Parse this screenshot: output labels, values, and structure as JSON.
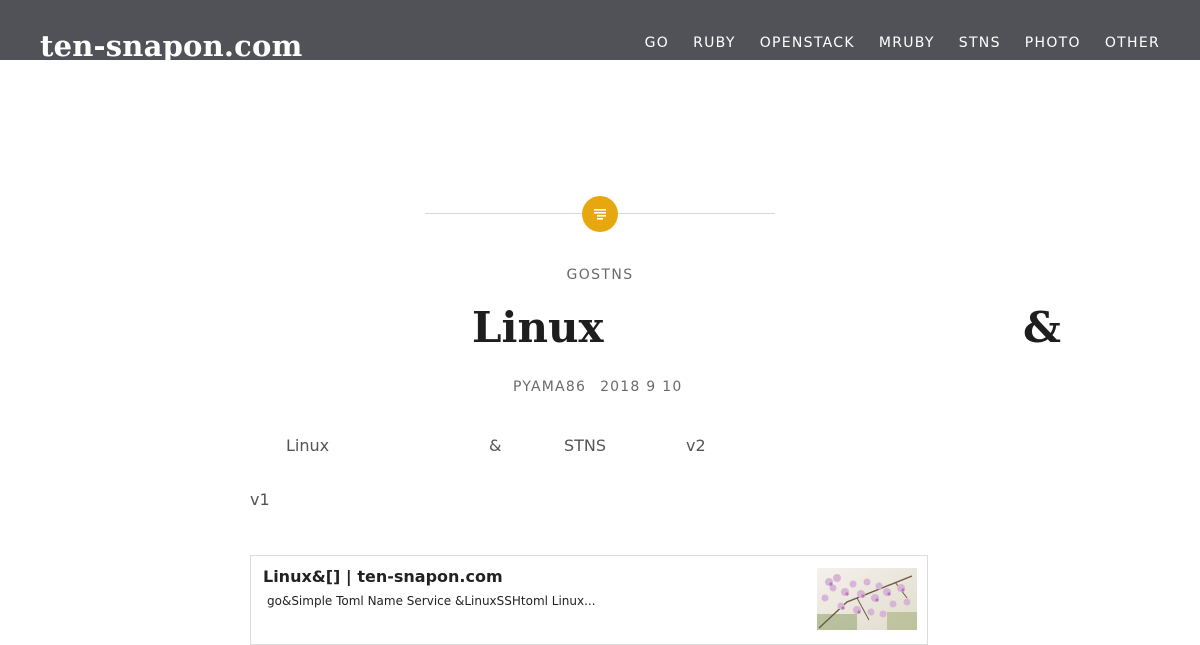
{
  "header": {
    "site_title": "ten-snapon.com",
    "nav": [
      {
        "label": "GO"
      },
      {
        "label": "RUBY"
      },
      {
        "label": "OPENSTACK"
      },
      {
        "label": "MRUBY"
      },
      {
        "label": "STNS"
      },
      {
        "label": "PHOTO"
      },
      {
        "label": "OTHER"
      }
    ],
    "background": "#505257"
  },
  "post": {
    "format_icon": "standard-post-icon",
    "accent_color": "#e6a711",
    "categories": [
      "GO",
      "STNS"
    ],
    "title_left": "Linux",
    "title_right": "&",
    "author": "PYAMA86",
    "date": "2018 9 10 ",
    "body": {
      "line1": {
        "a": "Linux",
        "b": "&",
        "c": "STNS",
        "d": "v2"
      },
      "line2": "v1"
    },
    "embed": {
      "title": "Linux&[] | ten-snapon.com",
      "excerpt": "go&Simple Toml Name Service &LinuxSSHtoml  Linux..."
    }
  }
}
